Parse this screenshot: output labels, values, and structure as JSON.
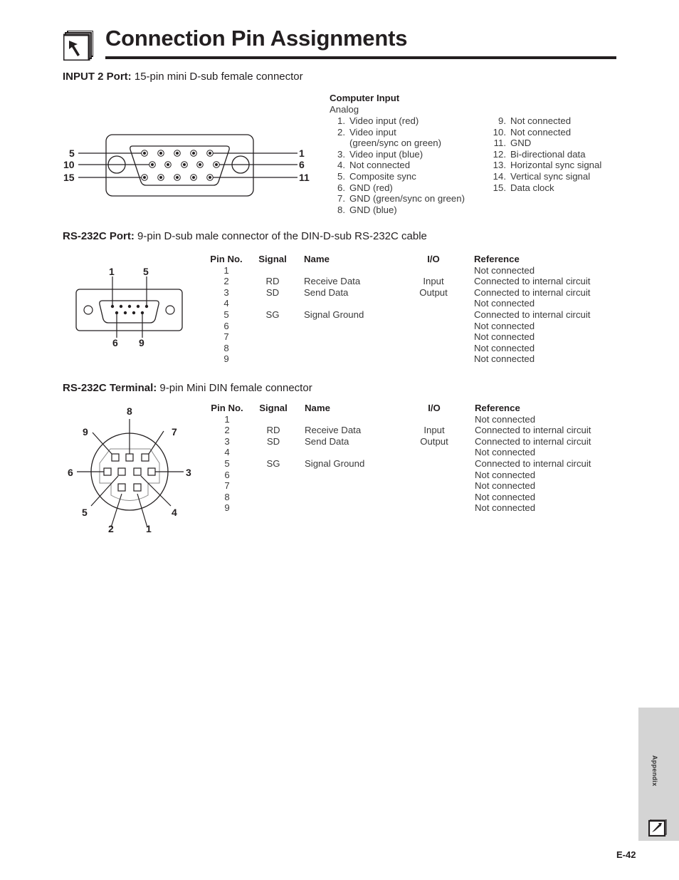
{
  "page": {
    "title": "Connection Pin Assignments",
    "side_tab": "Appendix",
    "page_number": "E-42"
  },
  "input2": {
    "heading_bold": "INPUT 2 Port:",
    "heading_rest": " 15-pin mini D-sub female connector",
    "connector_labels": {
      "left": [
        "5",
        "10",
        "15"
      ],
      "right": [
        "1",
        "6",
        "11"
      ]
    },
    "list_title": "Computer Input",
    "list_subtitle": "Analog",
    "col1": [
      {
        "num": "1.",
        "label": "Video input (red)"
      },
      {
        "num": "2.",
        "label": "Video input"
      },
      {
        "num": "",
        "label": "(green/sync on green)"
      },
      {
        "num": "3.",
        "label": "Video input (blue)"
      },
      {
        "num": "4.",
        "label": "Not connected"
      },
      {
        "num": "5.",
        "label": "Composite sync"
      },
      {
        "num": "6.",
        "label": "GND (red)"
      },
      {
        "num": "7.",
        "label": "GND (green/sync on green)"
      },
      {
        "num": "8.",
        "label": "GND (blue)"
      }
    ],
    "col2": [
      {
        "num": "9.",
        "label": "Not connected"
      },
      {
        "num": "10.",
        "label": "Not connected"
      },
      {
        "num": "11.",
        "label": "GND"
      },
      {
        "num": "12.",
        "label": "Bi-directional data"
      },
      {
        "num": "13.",
        "label": "Horizontal sync signal"
      },
      {
        "num": "14.",
        "label": "Vertical sync signal"
      },
      {
        "num": "15.",
        "label": "Data clock"
      }
    ]
  },
  "rs232c_port": {
    "heading_bold": "RS-232C Port:",
    "heading_rest": " 9-pin D-sub male connector of the DIN-D-sub RS-232C cable",
    "connector_labels": {
      "top": [
        "1",
        "5"
      ],
      "bottom": [
        "6",
        "9"
      ]
    },
    "columns": [
      "Pin No.",
      "Signal",
      "Name",
      "I/O",
      "Reference"
    ],
    "rows": [
      {
        "pin": "1",
        "signal": "",
        "name": "",
        "io": "",
        "reference": "Not connected"
      },
      {
        "pin": "2",
        "signal": "RD",
        "name": "Receive Data",
        "io": "Input",
        "reference": "Connected to internal circuit"
      },
      {
        "pin": "3",
        "signal": "SD",
        "name": "Send Data",
        "io": "Output",
        "reference": "Connected to internal circuit"
      },
      {
        "pin": "4",
        "signal": "",
        "name": "",
        "io": "",
        "reference": "Not connected"
      },
      {
        "pin": "5",
        "signal": "SG",
        "name": "Signal Ground",
        "io": "",
        "reference": "Connected to internal circuit"
      },
      {
        "pin": "6",
        "signal": "",
        "name": "",
        "io": "",
        "reference": "Not connected"
      },
      {
        "pin": "7",
        "signal": "",
        "name": "",
        "io": "",
        "reference": "Not connected"
      },
      {
        "pin": "8",
        "signal": "",
        "name": "",
        "io": "",
        "reference": "Not connected"
      },
      {
        "pin": "9",
        "signal": "",
        "name": "",
        "io": "",
        "reference": "Not connected"
      }
    ]
  },
  "rs232c_terminal": {
    "heading_bold": "RS-232C Terminal:",
    "heading_rest": " 9-pin Mini DIN female connector",
    "connector_labels": {
      "p1": "1",
      "p2": "2",
      "p3": "3",
      "p4": "4",
      "p5": "5",
      "p6": "6",
      "p7": "7",
      "p8": "8",
      "p9": "9"
    },
    "columns": [
      "Pin No.",
      "Signal",
      "Name",
      "I/O",
      "Reference"
    ],
    "rows": [
      {
        "pin": "1",
        "signal": "",
        "name": "",
        "io": "",
        "reference": "Not connected"
      },
      {
        "pin": "2",
        "signal": "RD",
        "name": "Receive Data",
        "io": "Input",
        "reference": "Connected to internal circuit"
      },
      {
        "pin": "3",
        "signal": "SD",
        "name": "Send Data",
        "io": "Output",
        "reference": "Connected to internal circuit"
      },
      {
        "pin": "4",
        "signal": "",
        "name": "",
        "io": "",
        "reference": "Not connected"
      },
      {
        "pin": "5",
        "signal": "SG",
        "name": "Signal Ground",
        "io": "",
        "reference": "Connected to internal circuit"
      },
      {
        "pin": "6",
        "signal": "",
        "name": "",
        "io": "",
        "reference": "Not connected"
      },
      {
        "pin": "7",
        "signal": "",
        "name": "",
        "io": "",
        "reference": "Not connected"
      },
      {
        "pin": "8",
        "signal": "",
        "name": "",
        "io": "",
        "reference": "Not connected"
      },
      {
        "pin": "9",
        "signal": "",
        "name": "",
        "io": "",
        "reference": "Not connected"
      }
    ]
  }
}
